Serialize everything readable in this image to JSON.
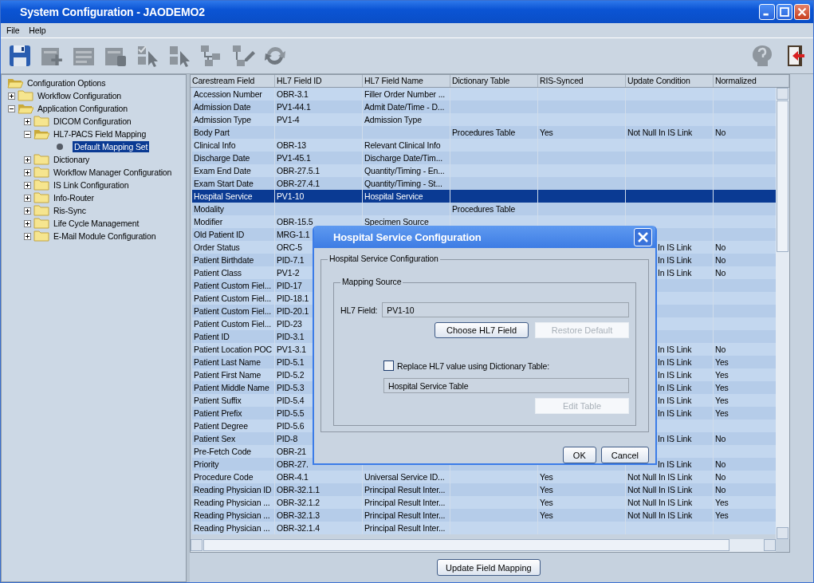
{
  "window": {
    "title": "System Configuration - JAODEMO2"
  },
  "menu": [
    "File",
    "Help"
  ],
  "toolbar": [
    {
      "kind": "save",
      "disabled": false
    },
    {
      "kind": "add",
      "disabled": true
    },
    {
      "kind": "list",
      "disabled": true
    },
    {
      "kind": "remove",
      "disabled": true
    },
    {
      "kind": "check-select",
      "disabled": true
    },
    {
      "kind": "select",
      "disabled": true
    },
    {
      "kind": "tree",
      "disabled": true
    },
    {
      "kind": "tree-edit",
      "disabled": true
    },
    {
      "kind": "refresh",
      "disabled": true
    },
    {
      "kind": "help",
      "disabled": true
    },
    {
      "kind": "exit",
      "disabled": false
    }
  ],
  "tree": {
    "label": "Configuration Options",
    "expanded": true,
    "selected": false,
    "children": [
      {
        "label": "Workflow Configuration",
        "expanded": false,
        "selected": false
      },
      {
        "label": "Application Configuration",
        "expanded": true,
        "selected": false,
        "children": [
          {
            "label": "DICOM Configuration",
            "expanded": false,
            "selected": false
          },
          {
            "label": "HL7-PACS Field Mapping",
            "expanded": true,
            "selected": false,
            "children": [
              {
                "label": "Default Mapping Set",
                "selected": true
              }
            ]
          },
          {
            "label": "Dictionary",
            "expanded": false,
            "selected": false
          },
          {
            "label": "Workflow Manager Configuration",
            "expanded": false,
            "selected": false
          },
          {
            "label": "IS Link Configuration",
            "expanded": false,
            "selected": false
          },
          {
            "label": "Info-Router",
            "expanded": false,
            "selected": false
          },
          {
            "label": "Ris-Sync",
            "expanded": false,
            "selected": false
          },
          {
            "label": "Life Cycle Management",
            "expanded": false,
            "selected": false
          },
          {
            "label": "E-Mail Module Configuration",
            "expanded": false,
            "selected": false
          }
        ]
      }
    ]
  },
  "table": {
    "columns": [
      "Carestream Field",
      "HL7 Field ID",
      "HL7 Field Name",
      "Dictionary Table",
      "RIS-Synced",
      "Update Condition",
      "Normalized"
    ],
    "rows": [
      {
        "selected": false,
        "cells": [
          "Accession Number",
          "OBR-3.1",
          "Filler Order Number ...",
          null,
          null,
          null,
          null
        ]
      },
      {
        "selected": false,
        "cells": [
          "Admission Date",
          "PV1-44.1",
          "Admit Date/Time - D...",
          null,
          null,
          null,
          null
        ]
      },
      {
        "selected": false,
        "cells": [
          "Admission Type",
          "PV1-4",
          "Admission Type",
          null,
          null,
          null,
          null
        ]
      },
      {
        "selected": false,
        "cells": [
          "Body Part",
          null,
          null,
          "Procedures Table",
          "Yes",
          "Not Null In IS Link",
          "No"
        ]
      },
      {
        "selected": false,
        "cells": [
          "Clinical Info",
          "OBR-13",
          "Relevant Clinical Info",
          null,
          null,
          null,
          null
        ]
      },
      {
        "selected": false,
        "cells": [
          "Discharge Date",
          "PV1-45.1",
          "Discharge Date/Tim...",
          null,
          null,
          null,
          null
        ]
      },
      {
        "selected": false,
        "cells": [
          "Exam End Date",
          "OBR-27.5.1",
          "Quantity/Timing - En...",
          null,
          null,
          null,
          null
        ]
      },
      {
        "selected": false,
        "cells": [
          "Exam Start Date",
          "OBR-27.4.1",
          "Quantity/Timing - St...",
          null,
          null,
          null,
          null
        ]
      },
      {
        "selected": true,
        "cells": [
          "Hospital Service",
          "PV1-10",
          "Hospital Service",
          null,
          null,
          null,
          null
        ]
      },
      {
        "selected": false,
        "cells": [
          "Modality",
          null,
          null,
          "Procedures Table",
          null,
          null,
          null
        ]
      },
      {
        "selected": false,
        "cells": [
          "Modifier",
          "OBR-15.5",
          "Specimen Source",
          null,
          null,
          null,
          null
        ]
      },
      {
        "selected": false,
        "cells": [
          "Old Patient ID",
          "MRG-1.1",
          null,
          null,
          null,
          null,
          null
        ]
      },
      {
        "selected": false,
        "partly_hidden": true,
        "cells": [
          "Order Status",
          "ORC-5",
          null,
          null,
          null,
          "In IS Link",
          "No"
        ]
      },
      {
        "selected": false,
        "partly_hidden": true,
        "cells": [
          "Patient Birthdate",
          "PID-7.1",
          null,
          null,
          null,
          "In IS Link",
          "No"
        ]
      },
      {
        "selected": false,
        "partly_hidden": true,
        "cells": [
          "Patient Class",
          "PV1-2",
          null,
          null,
          null,
          "In IS Link",
          "No"
        ]
      },
      {
        "selected": false,
        "cells": [
          "Patient Custom Fiel...",
          "PID-17",
          null,
          null,
          null,
          null,
          null
        ]
      },
      {
        "selected": false,
        "cells": [
          "Patient Custom Fiel...",
          "PID-18.1",
          null,
          null,
          null,
          null,
          null
        ]
      },
      {
        "selected": false,
        "cells": [
          "Patient Custom Fiel...",
          "PID-20.1",
          null,
          null,
          null,
          null,
          null
        ]
      },
      {
        "selected": false,
        "cells": [
          "Patient Custom Fiel...",
          "PID-23",
          null,
          null,
          null,
          null,
          null
        ]
      },
      {
        "selected": false,
        "cells": [
          "Patient ID",
          "PID-3.1",
          null,
          null,
          null,
          null,
          null
        ]
      },
      {
        "selected": false,
        "partly_hidden": true,
        "cells": [
          "Patient Location POC",
          "PV1-3.1",
          null,
          null,
          null,
          "In IS Link",
          "No"
        ]
      },
      {
        "selected": false,
        "partly_hidden": true,
        "cells": [
          "Patient Last Name",
          "PID-5.1",
          null,
          null,
          null,
          "In IS Link",
          "Yes"
        ]
      },
      {
        "selected": false,
        "partly_hidden": true,
        "cells": [
          "Patient First Name",
          "PID-5.2",
          null,
          null,
          null,
          "In IS Link",
          "Yes"
        ]
      },
      {
        "selected": false,
        "partly_hidden": true,
        "cells": [
          "Patient Middle Name",
          "PID-5.3",
          null,
          null,
          null,
          "In IS Link",
          "Yes"
        ]
      },
      {
        "selected": false,
        "partly_hidden": true,
        "cells": [
          "Patient Suffix",
          "PID-5.4",
          null,
          null,
          null,
          "In IS Link",
          "Yes"
        ]
      },
      {
        "selected": false,
        "partly_hidden": true,
        "cells": [
          "Patient Prefix",
          "PID-5.5",
          null,
          null,
          null,
          "In IS Link",
          "Yes"
        ]
      },
      {
        "selected": false,
        "cells": [
          "Patient Degree",
          "PID-5.6",
          null,
          null,
          null,
          null,
          null
        ]
      },
      {
        "selected": false,
        "partly_hidden": true,
        "cells": [
          "Patient Sex",
          "PID-8",
          null,
          null,
          null,
          "In IS Link",
          "No"
        ]
      },
      {
        "selected": false,
        "cells": [
          "Pre-Fetch Code",
          "OBR-21",
          null,
          null,
          null,
          null,
          null
        ]
      },
      {
        "selected": false,
        "partly_hidden": true,
        "cells": [
          "Priority",
          "OBR-27.",
          null,
          null,
          null,
          "In IS Link",
          "No"
        ]
      },
      {
        "selected": false,
        "cells": [
          "Procedure Code",
          "OBR-4.1",
          "Universal Service ID...",
          null,
          "Yes",
          "Not Null In IS Link",
          "No"
        ]
      },
      {
        "selected": false,
        "cells": [
          "Reading Physician ID",
          "OBR-32.1.1",
          "Principal Result Inter...",
          null,
          "Yes",
          "Not Null In IS Link",
          "No"
        ]
      },
      {
        "selected": false,
        "cells": [
          "Reading Physician ...",
          "OBR-32.1.2",
          "Principal Result Inter...",
          null,
          "Yes",
          "Not Null In IS Link",
          "Yes"
        ]
      },
      {
        "selected": false,
        "cells": [
          "Reading Physician ...",
          "OBR-32.1.3",
          "Principal Result Inter...",
          null,
          "Yes",
          "Not Null In IS Link",
          "Yes"
        ]
      },
      {
        "selected": false,
        "cells": [
          "Reading Physician ...",
          "OBR-32.1.4",
          "Principal Result Inter...",
          null,
          null,
          null,
          null
        ]
      }
    ]
  },
  "update_button": "Update Field Mapping",
  "dialog": {
    "title": "Hospital Service Configuration",
    "group_title": "Hospital Service Configuration",
    "source_title": "Mapping Source",
    "field_label": "HL7 Field:",
    "field_value": "PV1-10",
    "choose_button": {
      "label": "Choose HL7 Field",
      "disabled": false
    },
    "restore_button": {
      "label": "Restore Default",
      "disabled": true
    },
    "replace_checkbox": {
      "label": "Replace HL7 value using Dictionary Table:",
      "checked": false
    },
    "table_field": "Hospital Service Table",
    "edit_button": {
      "label": "Edit Table",
      "disabled": true
    },
    "ok_button": "OK",
    "cancel_button": "Cancel"
  }
}
